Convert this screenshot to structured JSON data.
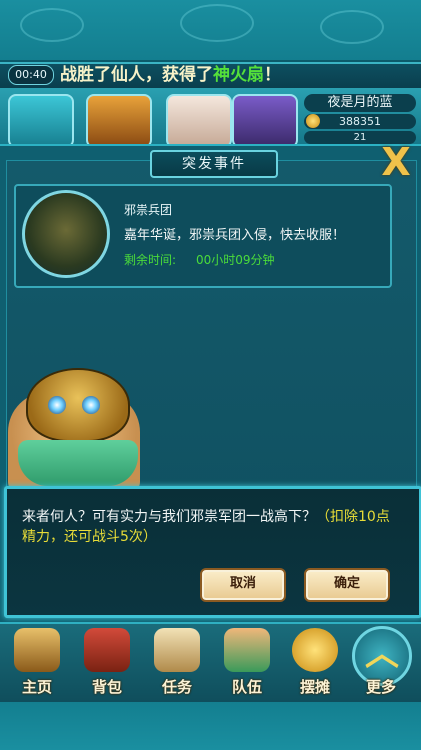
{
  "ticker": {
    "time": "00:40",
    "message_prefix": "战胜了仙人，获得了",
    "message_item": "神火扇",
    "message_suffix": "！"
  },
  "player": {
    "name": "夜是月的蓝",
    "coins": "388351",
    "stamina": "21"
  },
  "panel": {
    "title": "突发事件",
    "close_label": "X"
  },
  "event": {
    "name": "邪祟兵团",
    "description": "嘉年华诞，邪祟兵团入侵，快去收服！",
    "time_label": "剩余时间:",
    "time_value": "00小时09分钟"
  },
  "dialog": {
    "text": "来者何人？可有实力与我们邪祟军团一战高下？",
    "hint": "（扣除10点精力，还可战斗5次）",
    "cancel_label": "取消",
    "confirm_label": "确定"
  },
  "menu": {
    "items": [
      {
        "label": "主页",
        "icon": "pagoda-icon"
      },
      {
        "label": "背包",
        "icon": "treasure-chest-icon"
      },
      {
        "label": "任务",
        "icon": "scroll-icon"
      },
      {
        "label": "队伍",
        "icon": "team-icon"
      },
      {
        "label": "摆摊",
        "icon": "coin-icon"
      }
    ],
    "more_label": "更多"
  },
  "colors": {
    "highlight_green": "#54e03a",
    "hint_yellow": "#e7dc38",
    "dialog_border": "#3fc3d6"
  }
}
